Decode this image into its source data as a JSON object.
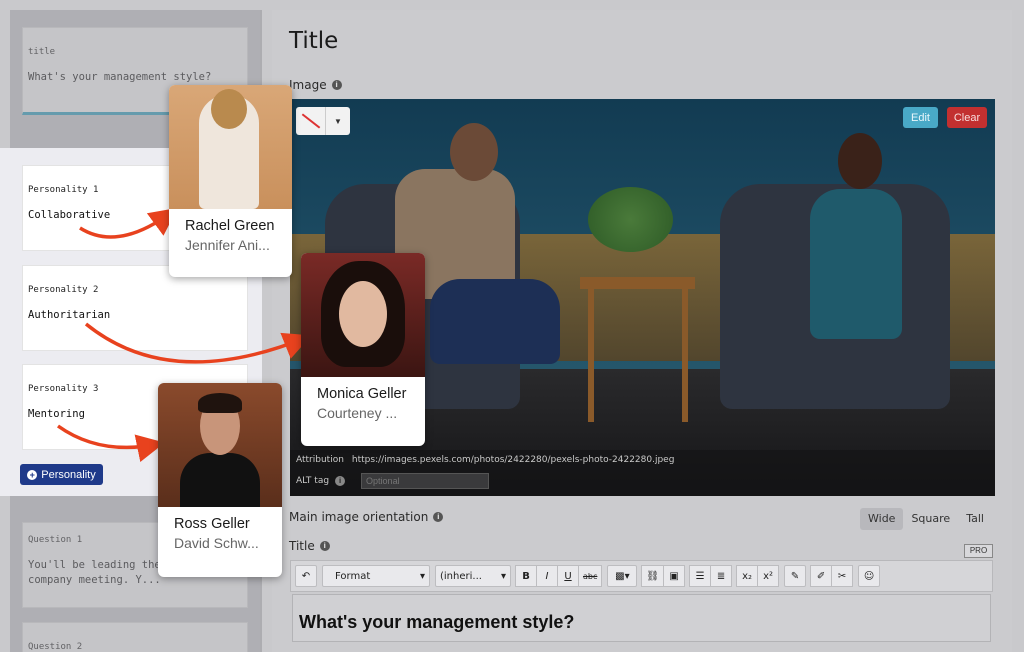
{
  "sidebar": {
    "title_card": {
      "label": "title",
      "value": "What's your management style?"
    },
    "personalities": [
      {
        "label": "Personality 1",
        "value": "Collaborative"
      },
      {
        "label": "Personality 2",
        "value": "Authoritarian"
      },
      {
        "label": "Personality 3",
        "value": "Mentoring"
      }
    ],
    "add_personality_label": "Personality",
    "questions": [
      {
        "label": "Question 1",
        "value": "You'll be leading the\ncompany meeting. Y..."
      },
      {
        "label": "Question 2",
        "value": ""
      }
    ]
  },
  "main": {
    "title": "Title",
    "image_label": "Image",
    "edit_label": "Edit",
    "clear_label": "Clear",
    "attribution_label": "Attribution",
    "attribution_url": "https://images.pexels.com/photos/2422280/pexels-photo-2422280.jpeg",
    "alt_label": "ALT tag",
    "alt_placeholder": "Optional",
    "orientation_label": "Main image orientation",
    "orientation_options": [
      "Wide",
      "Square",
      "Tall"
    ],
    "orientation_selected": "Wide",
    "title_field_label": "Title",
    "pro_badge": "PRO",
    "toolbar": {
      "format_label": "Format",
      "font_label": "(inheri...",
      "bold": "B",
      "italic": "I",
      "underline": "U",
      "strike": "abc",
      "sub": "x₂",
      "sup": "x²"
    },
    "editor_text": "What's your management style?"
  },
  "characters": [
    {
      "name": "Rachel Green",
      "actor": "Jennifer Ani..."
    },
    {
      "name": "Monica Geller",
      "actor": "Courteney ..."
    },
    {
      "name": "Ross Geller",
      "actor": "David Schw..."
    }
  ],
  "colors": {
    "primary_button": "#1f3a8a",
    "edit_button": "#49a9c7",
    "clear_button": "#c23030",
    "arrow": "#e8421e"
  }
}
